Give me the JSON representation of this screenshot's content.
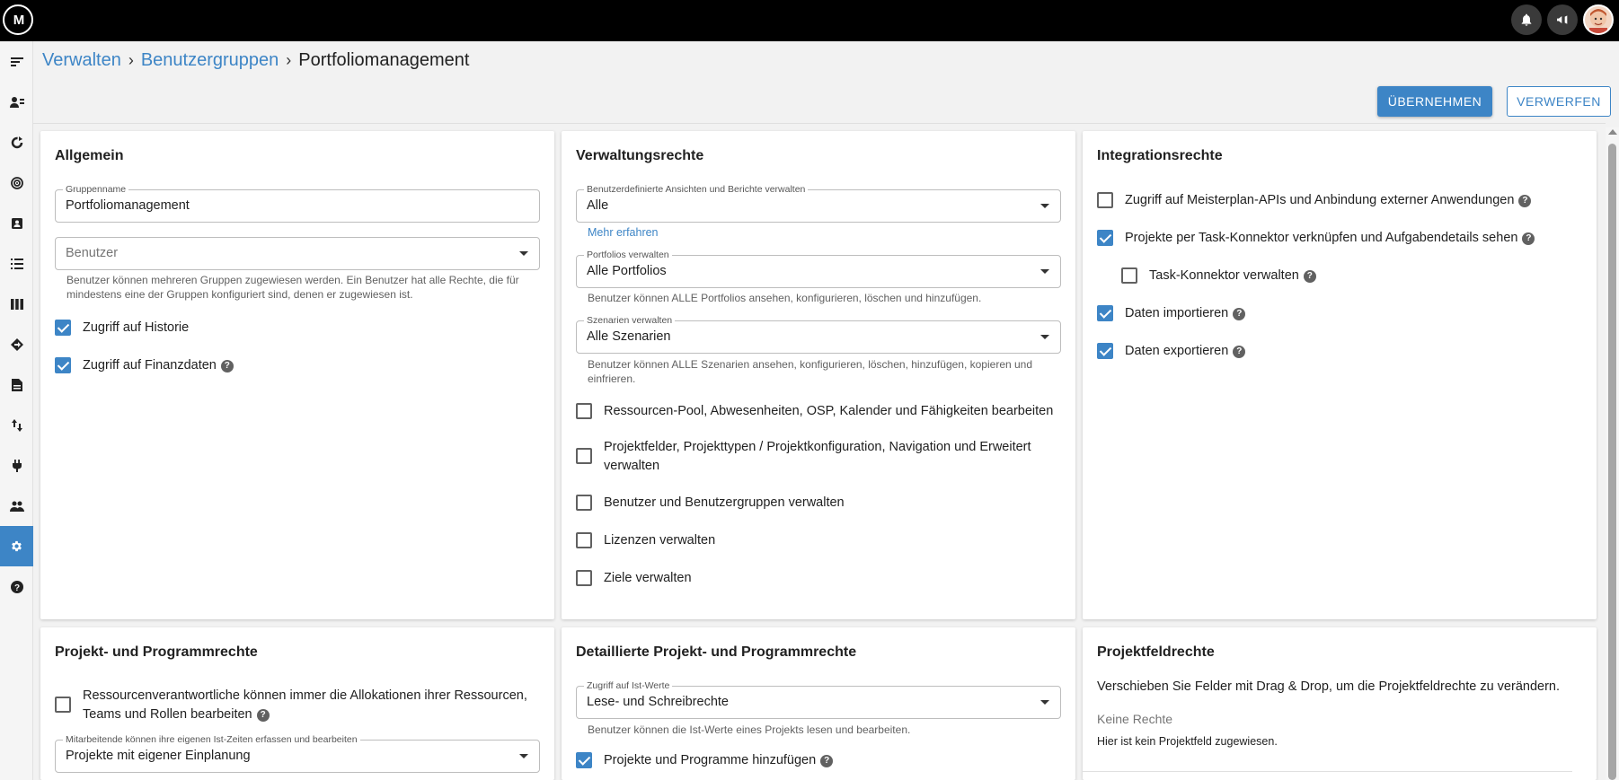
{
  "topbar": {
    "logo_text": "M",
    "icons": [
      "bell-icon",
      "megaphone-icon",
      "avatar"
    ]
  },
  "sidebar": {
    "items": [
      "menu-icon",
      "users-list-icon",
      "refresh-icon",
      "target-icon",
      "contact-card-icon",
      "list-icon",
      "columns-icon",
      "diamond-arrow-icon",
      "document-icon",
      "transfer-icon",
      "plug-icon",
      "people-icon",
      "gear-icon",
      "help-icon"
    ],
    "active": "gear-icon"
  },
  "breadcrumb": {
    "item1": "Verwalten",
    "item2": "Benutzergruppen",
    "current": "Portfoliomanagement",
    "separator": "›"
  },
  "actions": {
    "apply": "ÜBERNEHMEN",
    "discard": "VERWERFEN"
  },
  "allgemein": {
    "title": "Allgemein",
    "group_name_label": "Gruppenname",
    "group_name_value": "Portfoliomanagement",
    "users_placeholder": "Benutzer",
    "users_helper": "Benutzer können mehreren Gruppen zugewiesen werden. Ein Benutzer hat alle Rechte, die für mindestens eine der Gruppen konfiguriert sind, denen er zugewiesen ist.",
    "history_label": "Zugriff auf Historie",
    "finance_label": "Zugriff auf Finanzdaten"
  },
  "verwaltung": {
    "title": "Verwaltungsrechte",
    "views_label": "Benutzerdefinierte Ansichten und Berichte verwalten",
    "views_value": "Alle",
    "learn_more": "Mehr erfahren",
    "portfolios_label": "Portfolios verwalten",
    "portfolios_value": "Alle Portfolios",
    "portfolios_helper": "Benutzer können ALLE Portfolios ansehen, konfigurieren, löschen und hinzufügen.",
    "scenarios_label": "Szenarien verwalten",
    "scenarios_value": "Alle Szenarien",
    "scenarios_helper": "Benutzer können ALLE Szenarien ansehen, konfigurieren, löschen, hinzufügen, kopieren und einfrieren.",
    "cb1": "Ressourcen-Pool, Abwesenheiten, OSP, Kalender und Fähigkeiten bearbeiten",
    "cb2": "Projektfelder, Projekttypen / Projektkonfiguration, Navigation und Erweitert verwalten",
    "cb3": "Benutzer und Benutzergruppen verwalten",
    "cb4": "Lizenzen verwalten",
    "cb5": "Ziele verwalten"
  },
  "integration": {
    "title": "Integrationsrechte",
    "cb1": "Zugriff auf Meisterplan-APIs und Anbindung externer Anwendungen",
    "cb2": "Projekte per Task-Konnektor verknüpfen und Aufgabendetails sehen",
    "cb3": "Task-Konnektor verwalten",
    "cb4": "Daten importieren",
    "cb5": "Daten exportieren"
  },
  "projekt": {
    "title": "Projekt- und Programmrechte",
    "cb1": "Ressourcenverantwortliche können immer die Allokationen ihrer Ressourcen, Teams und Rollen bearbeiten",
    "actuals_label": "Mitarbeitende können ihre eigenen Ist-Zeiten erfassen und bearbeiten",
    "actuals_value": "Projekte mit eigener Einplanung"
  },
  "detail": {
    "title": "Detaillierte Projekt- und Programmrechte",
    "actuals_label": "Zugriff auf Ist-Werte",
    "actuals_value": "Lese- und Schreibrechte",
    "actuals_helper": "Benutzer können die Ist-Werte eines Projekts lesen und bearbeiten.",
    "cb1": "Projekte und Programme hinzufügen"
  },
  "projektfeld": {
    "title": "Projektfeldrechte",
    "description": "Verschieben Sie Felder mit Drag & Drop, um die Projektfeldrechte zu verändern.",
    "no_rights": "Keine Rechte",
    "empty": "Hier ist kein Projektfeld zugewiesen."
  },
  "help_glyph": "?"
}
